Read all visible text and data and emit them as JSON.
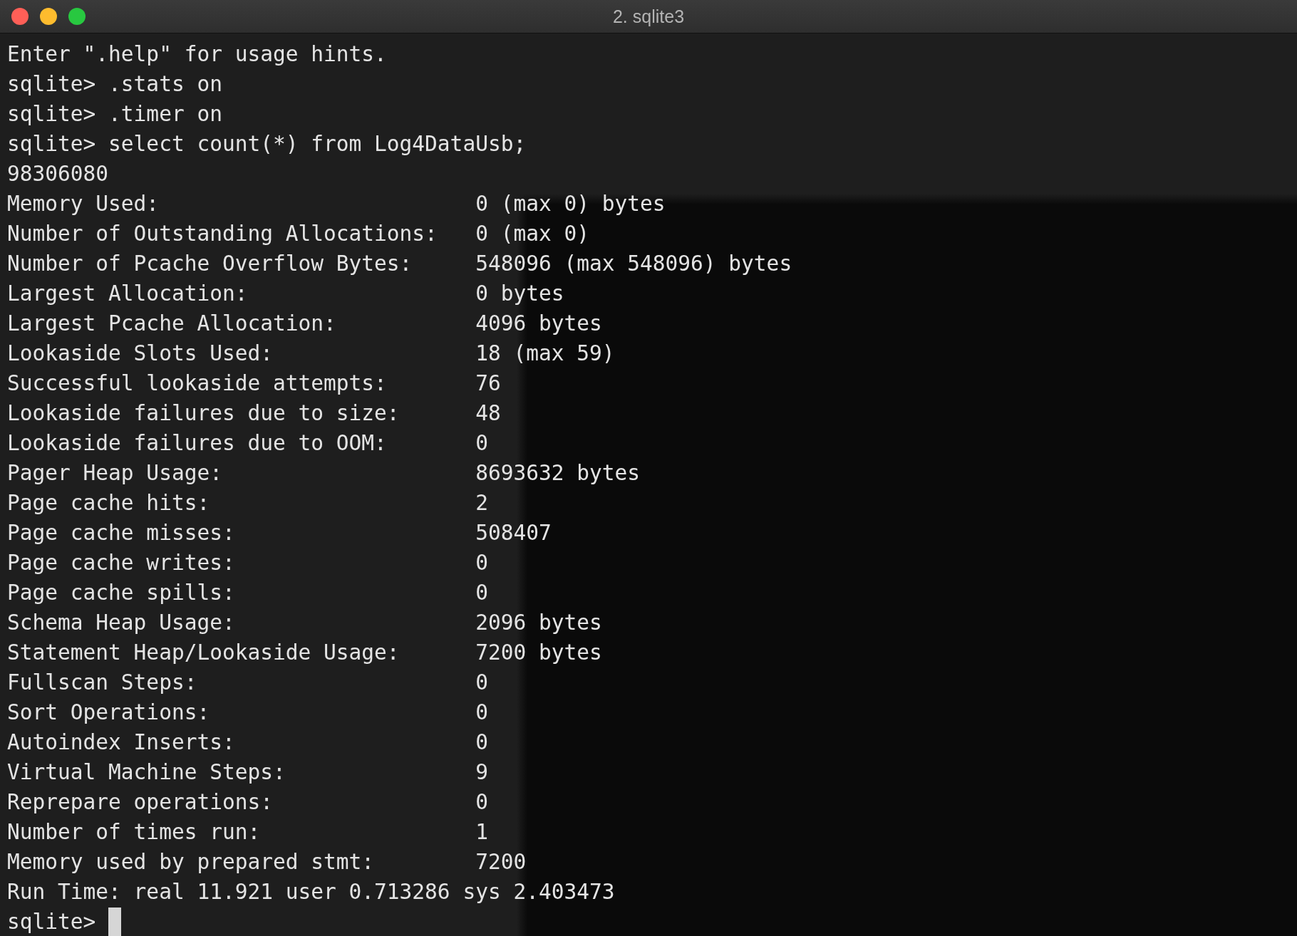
{
  "window": {
    "title": "2. sqlite3"
  },
  "lines": [
    {
      "kind": "text",
      "text": "Enter \".help\" for usage hints."
    },
    {
      "kind": "text",
      "text": "sqlite> .stats on"
    },
    {
      "kind": "text",
      "text": "sqlite> .timer on"
    },
    {
      "kind": "text",
      "text": "sqlite> select count(*) from Log4DataUsb;"
    },
    {
      "kind": "text",
      "text": "98306080"
    },
    {
      "kind": "stat",
      "label": "Memory Used:",
      "value": "0 (max 0) bytes"
    },
    {
      "kind": "stat",
      "label": "Number of Outstanding Allocations:",
      "value": "0 (max 0)"
    },
    {
      "kind": "stat",
      "label": "Number of Pcache Overflow Bytes:",
      "value": "548096 (max 548096) bytes"
    },
    {
      "kind": "stat",
      "label": "Largest Allocation:",
      "value": "0 bytes"
    },
    {
      "kind": "stat",
      "label": "Largest Pcache Allocation:",
      "value": "4096 bytes"
    },
    {
      "kind": "stat",
      "label": "Lookaside Slots Used:",
      "value": "18 (max 59)"
    },
    {
      "kind": "stat",
      "label": "Successful lookaside attempts:",
      "value": "76"
    },
    {
      "kind": "stat",
      "label": "Lookaside failures due to size:",
      "value": "48"
    },
    {
      "kind": "stat",
      "label": "Lookaside failures due to OOM:",
      "value": "0"
    },
    {
      "kind": "stat",
      "label": "Pager Heap Usage:",
      "value": "8693632 bytes"
    },
    {
      "kind": "stat",
      "label": "Page cache hits:",
      "value": "2"
    },
    {
      "kind": "stat",
      "label": "Page cache misses:",
      "value": "508407"
    },
    {
      "kind": "stat",
      "label": "Page cache writes:",
      "value": "0"
    },
    {
      "kind": "stat",
      "label": "Page cache spills:",
      "value": "0"
    },
    {
      "kind": "stat",
      "label": "Schema Heap Usage:",
      "value": "2096 bytes"
    },
    {
      "kind": "stat",
      "label": "Statement Heap/Lookaside Usage:",
      "value": "7200 bytes"
    },
    {
      "kind": "stat",
      "label": "Fullscan Steps:",
      "value": "0"
    },
    {
      "kind": "stat",
      "label": "Sort Operations:",
      "value": "0"
    },
    {
      "kind": "stat",
      "label": "Autoindex Inserts:",
      "value": "0"
    },
    {
      "kind": "stat",
      "label": "Virtual Machine Steps:",
      "value": "9"
    },
    {
      "kind": "stat",
      "label": "Reprepare operations:",
      "value": "0"
    },
    {
      "kind": "stat",
      "label": "Number of times run:",
      "value": "1"
    },
    {
      "kind": "stat",
      "label": "Memory used by prepared stmt:",
      "value": "7200"
    },
    {
      "kind": "text",
      "text": "Run Time: real 11.921 user 0.713286 sys 2.403473"
    },
    {
      "kind": "prompt",
      "text": "sqlite>"
    }
  ]
}
